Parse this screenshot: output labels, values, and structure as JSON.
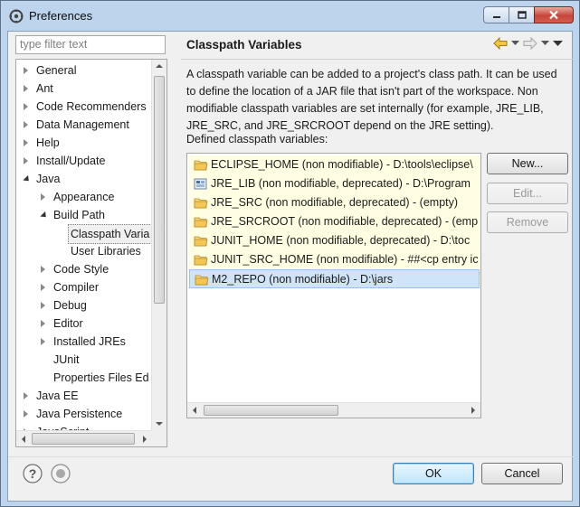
{
  "window": {
    "title": "Preferences",
    "controls": [
      "minimize-button",
      "maximize-button",
      "close-button"
    ]
  },
  "filter": {
    "placeholder": "type filter text"
  },
  "tree": {
    "items": [
      {
        "label": "General",
        "level": 0,
        "expander": "closed"
      },
      {
        "label": "Ant",
        "level": 0,
        "expander": "closed"
      },
      {
        "label": "Code Recommenders",
        "level": 0,
        "expander": "closed"
      },
      {
        "label": "Data Management",
        "level": 0,
        "expander": "closed"
      },
      {
        "label": "Help",
        "level": 0,
        "expander": "closed"
      },
      {
        "label": "Install/Update",
        "level": 0,
        "expander": "closed"
      },
      {
        "label": "Java",
        "level": 0,
        "expander": "open"
      },
      {
        "label": "Appearance",
        "level": 1,
        "expander": "closed"
      },
      {
        "label": "Build Path",
        "level": 1,
        "expander": "open"
      },
      {
        "label": "Classpath Varia",
        "level": 2,
        "expander": "none",
        "selected": true
      },
      {
        "label": "User Libraries",
        "level": 2,
        "expander": "none"
      },
      {
        "label": "Code Style",
        "level": 1,
        "expander": "closed"
      },
      {
        "label": "Compiler",
        "level": 1,
        "expander": "closed"
      },
      {
        "label": "Debug",
        "level": 1,
        "expander": "closed"
      },
      {
        "label": "Editor",
        "level": 1,
        "expander": "closed"
      },
      {
        "label": "Installed JREs",
        "level": 1,
        "expander": "closed"
      },
      {
        "label": "JUnit",
        "level": 1,
        "expander": "none"
      },
      {
        "label": "Properties Files Ed",
        "level": 1,
        "expander": "none"
      },
      {
        "label": "Java EE",
        "level": 0,
        "expander": "closed"
      },
      {
        "label": "Java Persistence",
        "level": 0,
        "expander": "closed"
      },
      {
        "label": "JavaScript",
        "level": 0,
        "expander": "closed"
      }
    ]
  },
  "page": {
    "title": "Classpath Variables",
    "description": "A classpath variable can be added to a project's class path. It can be used to define the location of a JAR file that isn't part of the workspace. Non modifiable classpath variables are set internally (for example, JRE_LIB, JRE_SRC, and JRE_SRCROOT depend on the JRE setting).",
    "defined_label": "Defined classpath variables:",
    "variables": [
      {
        "text": "ECLIPSE_HOME (non modifiable) - D:\\tools\\eclipse\\",
        "icon": "folder-icon",
        "nonmod": true
      },
      {
        "text": "JRE_LIB (non modifiable, deprecated) - D:\\Program",
        "icon": "jar-icon",
        "nonmod": true
      },
      {
        "text": "JRE_SRC (non modifiable, deprecated) - (empty)",
        "icon": "folder-icon",
        "nonmod": true
      },
      {
        "text": "JRE_SRCROOT (non modifiable, deprecated) - (emp",
        "icon": "folder-icon",
        "nonmod": true
      },
      {
        "text": "JUNIT_HOME (non modifiable, deprecated) - D:\\toc",
        "icon": "folder-icon",
        "nonmod": true
      },
      {
        "text": "JUNIT_SRC_HOME (non modifiable) - ##<cp entry ic",
        "icon": "folder-icon",
        "nonmod": true
      },
      {
        "text": "M2_REPO (non modifiable) - D:\\jars",
        "icon": "folder-icon",
        "nonmod": false,
        "selected": true
      }
    ],
    "buttons": {
      "new": "New...",
      "edit": "Edit...",
      "remove": "Remove"
    }
  },
  "footer": {
    "ok": "OK",
    "cancel": "Cancel"
  },
  "colors": {
    "nonmod_bg": "#fffee2",
    "selection": "#cfe4f8",
    "title_bar": "#bcd4ec"
  }
}
